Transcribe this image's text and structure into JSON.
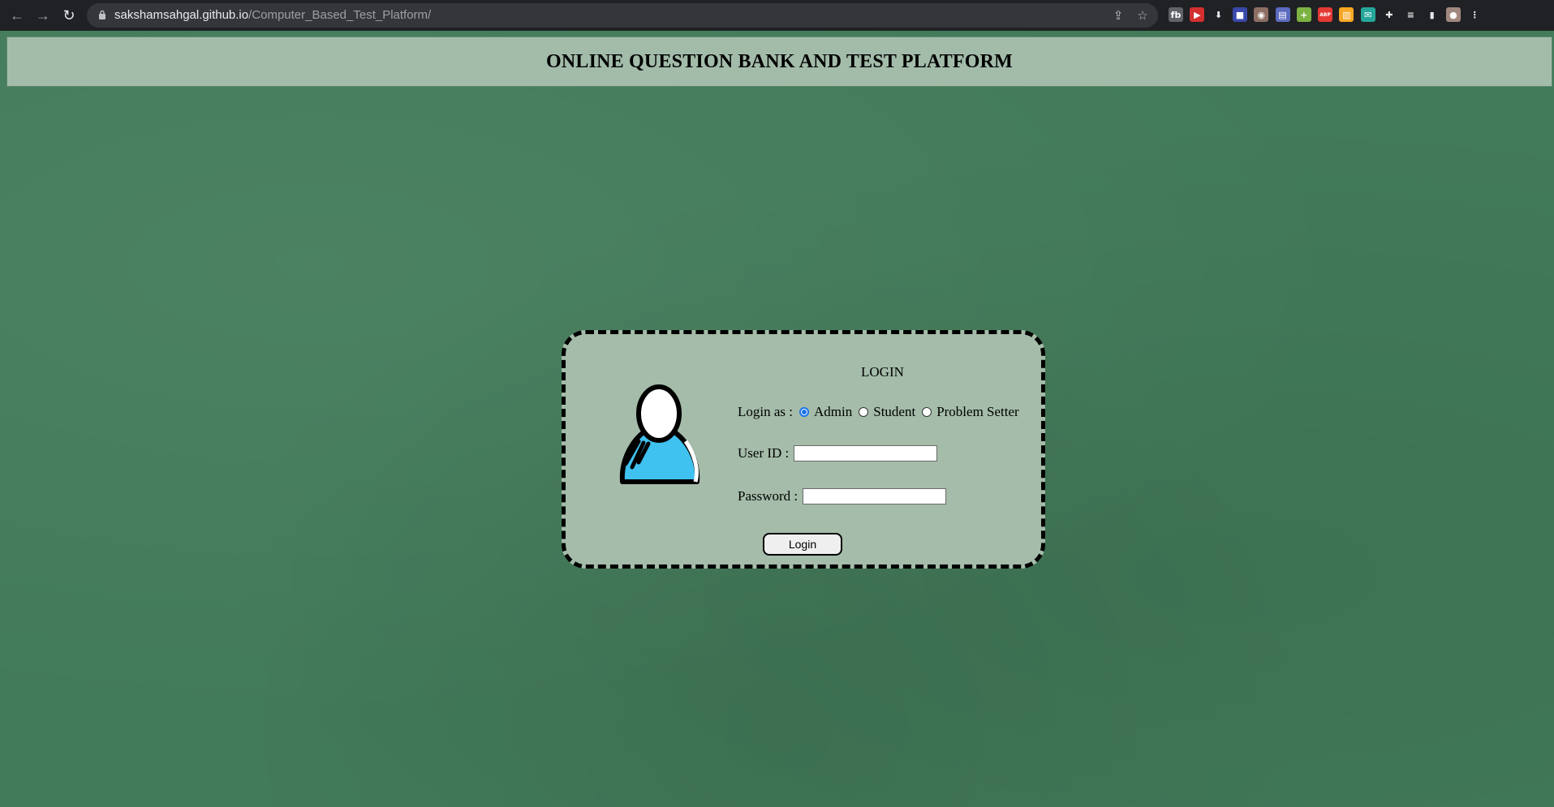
{
  "browser": {
    "url_host": "sakshamsahgal.github.io",
    "url_path": "/Computer_Based_Test_Platform/",
    "extensions": [
      {
        "name": "extension-1-icon",
        "color": "#5f6368",
        "glyph": "fb"
      },
      {
        "name": "extension-2-icon",
        "color": "#d32f2f",
        "glyph": "▶"
      },
      {
        "name": "download-icon",
        "color": "#202124",
        "glyph": "⬇"
      },
      {
        "name": "extension-4-icon",
        "color": "#3949ab",
        "glyph": "■"
      },
      {
        "name": "extension-5-icon",
        "color": "#8d6e63",
        "glyph": "◉"
      },
      {
        "name": "extension-6-icon",
        "color": "#5c6bc0",
        "glyph": "▤"
      },
      {
        "name": "extension-7-icon",
        "color": "#7cb342",
        "glyph": "+"
      },
      {
        "name": "adblock-icon",
        "color": "#e53935",
        "glyph": "ABP"
      },
      {
        "name": "extension-9-icon",
        "color": "#f9a825",
        "glyph": "▥"
      },
      {
        "name": "extension-10-icon",
        "color": "#26a69a",
        "glyph": "✉"
      },
      {
        "name": "puzzle-icon",
        "color": "#202124",
        "glyph": "✚"
      },
      {
        "name": "playlist-icon",
        "color": "#202124",
        "glyph": "≡"
      },
      {
        "name": "side-panel-icon",
        "color": "#202124",
        "glyph": "▮"
      },
      {
        "name": "profile-avatar-icon",
        "color": "#a1887f",
        "glyph": "●"
      },
      {
        "name": "menu-icon",
        "color": "#202124",
        "glyph": "⋮"
      }
    ]
  },
  "header": {
    "title": "ONLINE QUESTION BANK AND TEST PLATFORM"
  },
  "login_card": {
    "title": "LOGIN",
    "login_as_label": "Login as :",
    "roles": [
      {
        "label": "Admin",
        "selected": true
      },
      {
        "label": "Student",
        "selected": false
      },
      {
        "label": "Problem Setter",
        "selected": false
      }
    ],
    "user_id_label": "User ID :",
    "user_id_value": "",
    "password_label": "Password :",
    "password_value": "",
    "login_button": "Login",
    "avatar_colors": {
      "body": "#3fc2f0",
      "outline": "#000000",
      "head": "#ffffff"
    }
  }
}
